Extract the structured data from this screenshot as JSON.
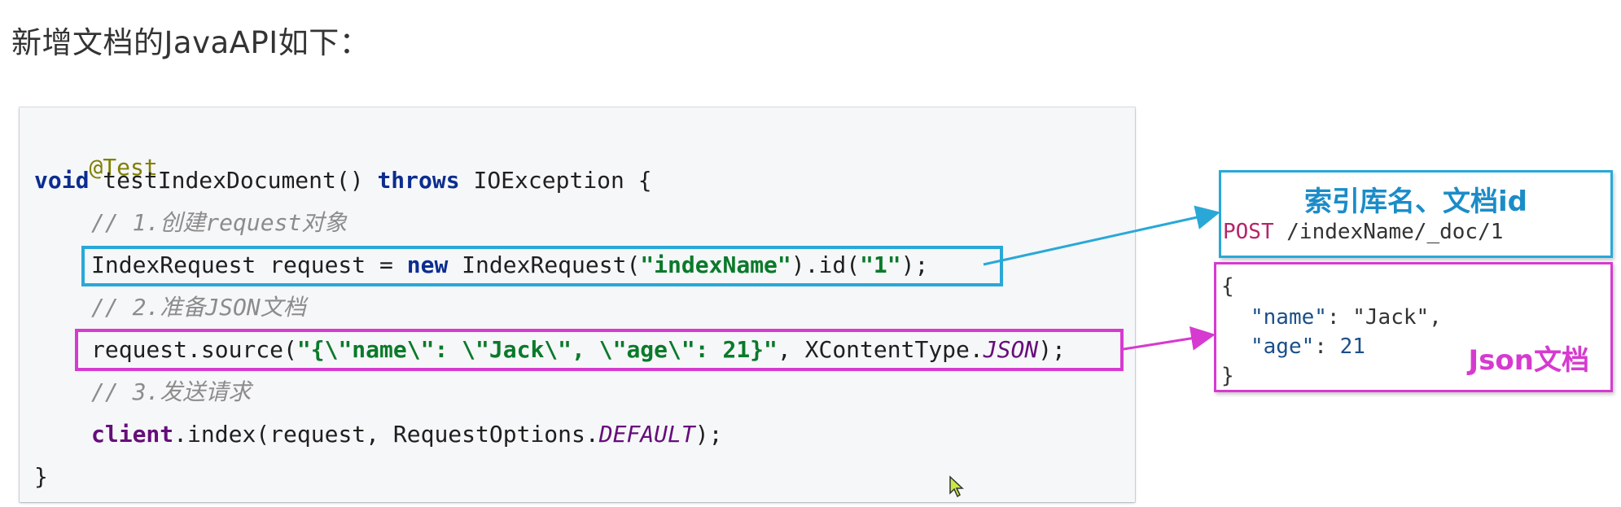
{
  "heading": "新增文档的JavaAPI如下：",
  "code": {
    "annotation": "@Test",
    "line2": {
      "kw_void": "void",
      "method": " testIndexDocument() ",
      "kw_throws": "throws",
      "rest": " IOException {"
    },
    "comment1": "// 1.创建request对象",
    "line4": {
      "a": "IndexRequest request = ",
      "kw_new": "new",
      "b": " IndexRequest(",
      "str1": "\"indexName\"",
      "c": ").id(",
      "str2": "\"1\"",
      "d": ");"
    },
    "comment2": "// 2.准备JSON文档",
    "line6": {
      "a": "request.source(",
      "str": "\"{\\\"name\\\": \\\"Jack\\\", \\\"age\\\": 21}\"",
      "b": ", XContentType.",
      "ital": "JSON",
      "c": ");"
    },
    "comment3": "// 3.发送请求",
    "line8": {
      "field": "client",
      "a": ".index(request, RequestOptions.",
      "ital": "DEFAULT",
      "b": ");"
    },
    "closing": "}"
  },
  "request_panel": {
    "title": "索引库名、文档id",
    "method": "POST",
    "path": " /indexName/_doc/1"
  },
  "json_panel": {
    "open": "{",
    "key1": "\"name\"",
    "sep1": ": ",
    "val1": "\"Jack\",",
    "key2": "\"age\"",
    "sep2": ": ",
    "val2": "21",
    "close": "}",
    "label": "Json文档"
  },
  "colors": {
    "blue_highlight": "#29a8d8",
    "pink_highlight": "#d63ad0"
  }
}
